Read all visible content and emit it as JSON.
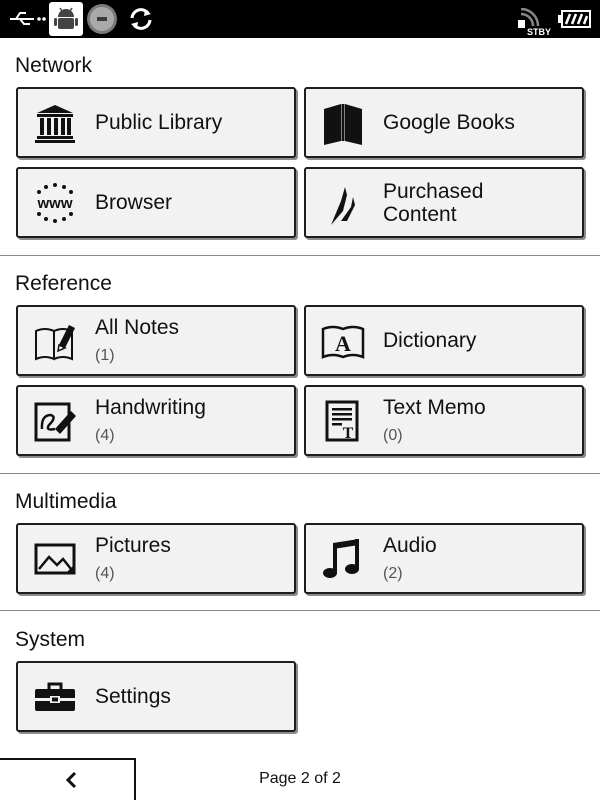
{
  "status_bar": {
    "icons": [
      "usb-icon",
      "android-debug-icon",
      "record-icon",
      "sync-icon",
      "wifi-standby-icon",
      "battery-icon"
    ],
    "wifi_state": "STBY"
  },
  "sections": {
    "network": {
      "title": "Network",
      "tiles": [
        {
          "label": "Public Library",
          "icon": "library-icon"
        },
        {
          "label": "Google Books",
          "icon": "book-icon"
        },
        {
          "label": "Browser",
          "icon": "www-icon"
        },
        {
          "label": "Purchased Content",
          "label_line1": "Purchased",
          "label_line2": "Content",
          "icon": "store-icon"
        }
      ]
    },
    "reference": {
      "title": "Reference",
      "tiles": [
        {
          "label": "All Notes",
          "count": "(1)",
          "icon": "notes-icon"
        },
        {
          "label": "Dictionary",
          "icon": "dictionary-icon"
        },
        {
          "label": "Handwriting",
          "count": "(4)",
          "icon": "handwriting-icon"
        },
        {
          "label": "Text Memo",
          "count": "(0)",
          "icon": "text-memo-icon"
        }
      ]
    },
    "multimedia": {
      "title": "Multimedia",
      "tiles": [
        {
          "label": "Pictures",
          "count": "(4)",
          "icon": "pictures-icon"
        },
        {
          "label": "Audio",
          "count": "(2)",
          "icon": "music-icon"
        }
      ]
    },
    "system": {
      "title": "System",
      "tiles": [
        {
          "label": "Settings",
          "icon": "toolbox-icon"
        }
      ]
    }
  },
  "footer": {
    "back_glyph": "‹",
    "page_indicator": "Page 2 of 2"
  }
}
